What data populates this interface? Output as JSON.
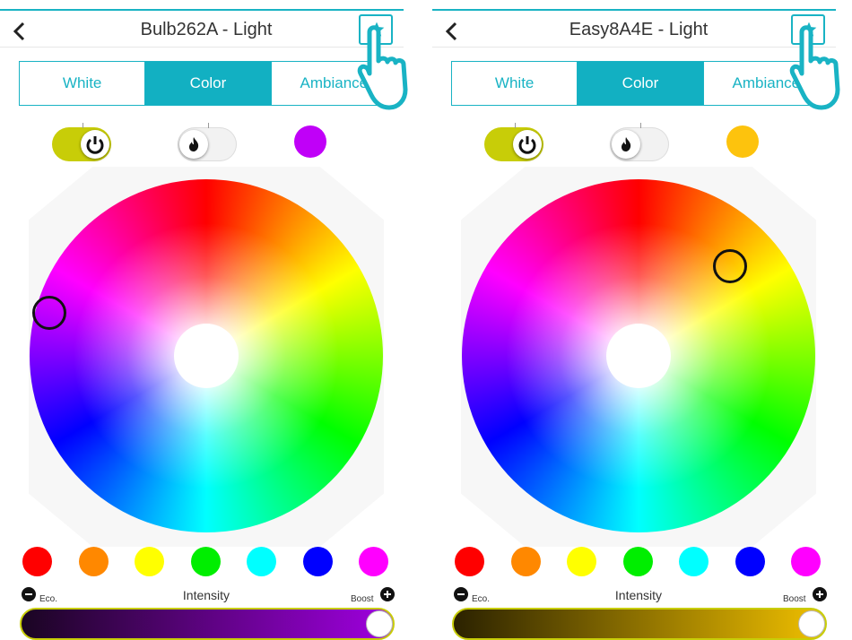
{
  "panels": [
    {
      "title": "Bulb262A - Light",
      "tabs": [
        "White",
        "Color",
        "Ambiance"
      ],
      "active_tab": "Color",
      "power_on": true,
      "selected_color": "#c000f8",
      "selector_color": "#ff00ff",
      "intensity_label": "Intensity",
      "eco_label": "Eco.",
      "boost_label": "Boost",
      "slider_gradient": [
        "#1a0522",
        "#a000e0"
      ],
      "slider_level": 1.0
    },
    {
      "title": "Easy8A4E - Light",
      "tabs": [
        "White",
        "Color",
        "Ambiance"
      ],
      "active_tab": "Color",
      "power_on": true,
      "selected_color": "#fdc30d",
      "selector_color": "#ffbb00",
      "intensity_label": "Intensity",
      "eco_label": "Eco.",
      "boost_label": "Boost",
      "slider_gradient": [
        "#2b2200",
        "#f0c000"
      ],
      "slider_level": 1.0
    }
  ],
  "presets": [
    "#ff0000",
    "#ff8800",
    "#ffff00",
    "#00ee00",
    "#00ffff",
    "#0000ff",
    "#ff00ff"
  ],
  "icons": {
    "back": "chevron-left-icon",
    "favorite": "star-icon",
    "power": "power-icon",
    "flame": "flame-icon",
    "pointer": "hand-pointer-icon"
  },
  "accent_color": "#19b3c4",
  "toggle_color": "#c8cd08"
}
